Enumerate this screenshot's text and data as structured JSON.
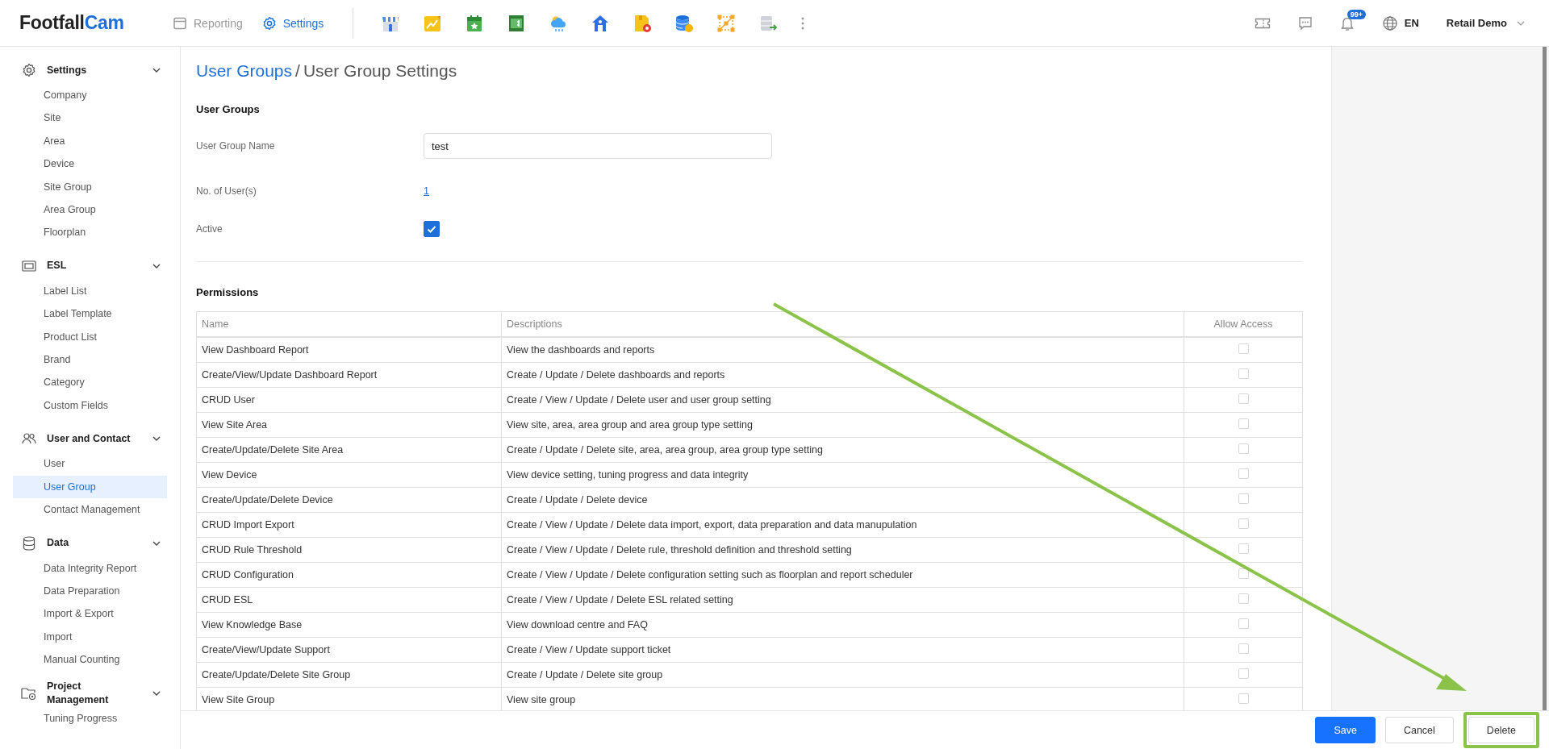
{
  "topbar": {
    "logo": {
      "first": "Footfall",
      "second": "Cam"
    },
    "nav": [
      {
        "label": "Reporting",
        "selected": false
      },
      {
        "label": "Settings",
        "selected": true
      }
    ],
    "notification_badge": "99+",
    "language": "EN",
    "account": "Retail Demo"
  },
  "sidebar": {
    "sections": [
      {
        "label": "Settings",
        "expanded": true,
        "items": [
          {
            "label": "Company",
            "selected": false
          },
          {
            "label": "Site",
            "selected": false
          },
          {
            "label": "Area",
            "selected": false
          },
          {
            "label": "Device",
            "selected": false
          },
          {
            "label": "Site Group",
            "selected": false
          },
          {
            "label": "Area Group",
            "selected": false
          },
          {
            "label": "Floorplan",
            "selected": false
          }
        ]
      },
      {
        "label": "ESL",
        "expanded": true,
        "items": [
          {
            "label": "Label List",
            "selected": false
          },
          {
            "label": "Label Template",
            "selected": false
          },
          {
            "label": "Product List",
            "selected": false
          },
          {
            "label": "Brand",
            "selected": false
          },
          {
            "label": "Category",
            "selected": false
          },
          {
            "label": "Custom Fields",
            "selected": false
          }
        ]
      },
      {
        "label": "User and Contact",
        "expanded": true,
        "items": [
          {
            "label": "User",
            "selected": false
          },
          {
            "label": "User Group",
            "selected": true
          },
          {
            "label": "Contact Management",
            "selected": false
          }
        ]
      },
      {
        "label": "Data",
        "expanded": true,
        "items": [
          {
            "label": "Data Integrity Report",
            "selected": false
          },
          {
            "label": "Data Preparation",
            "selected": false
          },
          {
            "label": "Import & Export",
            "selected": false
          },
          {
            "label": "Import",
            "selected": false
          },
          {
            "label": "Manual Counting",
            "selected": false
          }
        ]
      },
      {
        "label": "Project Management",
        "expanded": true,
        "items": [
          {
            "label": "Tuning Progress",
            "selected": false
          }
        ]
      }
    ]
  },
  "breadcrumb": {
    "parent": "User Groups",
    "separator": "/",
    "current": "User Group Settings"
  },
  "form": {
    "title": "User Groups",
    "fields": [
      {
        "kind": "text",
        "label": "User Group Name",
        "value": "test"
      },
      {
        "kind": "link",
        "label": "No. of User(s)",
        "value": "1"
      },
      {
        "kind": "checkbox",
        "label": "Active",
        "checked": true
      }
    ]
  },
  "permissions": {
    "title": "Permissions",
    "columns": [
      "Name",
      "Descriptions",
      "Allow Access"
    ],
    "rows": [
      {
        "name": "View Dashboard Report",
        "description": "View the dashboards and reports",
        "allowed": false
      },
      {
        "name": "Create/View/Update Dashboard Report",
        "description": "Create / Update / Delete dashboards and reports",
        "allowed": false
      },
      {
        "name": "CRUD User",
        "description": "Create / View / Update / Delete user and user group setting",
        "allowed": false
      },
      {
        "name": "View Site Area",
        "description": "View site, area, area group and area group type setting",
        "allowed": false
      },
      {
        "name": "Create/Update/Delete Site Area",
        "description": "Create / Update / Delete site, area, area group, area group type setting",
        "allowed": false
      },
      {
        "name": "View Device",
        "description": "View device setting, tuning progress and data integrity",
        "allowed": false
      },
      {
        "name": "Create/Update/Delete Device",
        "description": "Create / Update / Delete device",
        "allowed": false
      },
      {
        "name": "CRUD Import Export",
        "description": "Create / View / Update / Delete data import, export, data preparation and data manupulation",
        "allowed": false
      },
      {
        "name": "CRUD Rule Threshold",
        "description": "Create / View / Update / Delete rule, threshold definition and threshold setting",
        "allowed": false
      },
      {
        "name": "CRUD Configuration",
        "description": "Create / View / Update / Delete configuration setting such as floorplan and report scheduler",
        "allowed": false
      },
      {
        "name": "CRUD ESL",
        "description": "Create / View / Update / Delete ESL related setting",
        "allowed": false
      },
      {
        "name": "View Knowledge Base",
        "description": "View download centre and FAQ",
        "allowed": false
      },
      {
        "name": "Create/View/Update Support",
        "description": "Create / View / Update support ticket",
        "allowed": false
      },
      {
        "name": "Create/Update/Delete Site Group",
        "description": "Create / Update / Delete site group",
        "allowed": false
      },
      {
        "name": "View Site Group",
        "description": "View site group",
        "allowed": false
      }
    ]
  },
  "actions": [
    {
      "label": "Save",
      "kind": "primary",
      "highlighted": false
    },
    {
      "label": "Cancel",
      "kind": "default",
      "highlighted": false
    },
    {
      "label": "Delete",
      "kind": "default",
      "highlighted": true
    }
  ]
}
